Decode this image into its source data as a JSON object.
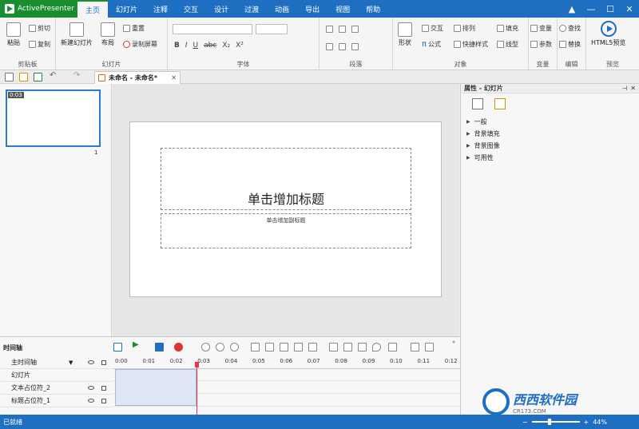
{
  "app": {
    "name": "ActivePresenter"
  },
  "tabs": [
    "主页",
    "幻灯片",
    "注释",
    "交互",
    "设计",
    "过渡",
    "动画",
    "导出",
    "视图",
    "帮助"
  ],
  "window_controls": [
    "▲",
    "—",
    "☐",
    "✕"
  ],
  "ribbon": {
    "clipboard": {
      "paste": "粘贴",
      "cut": "剪切",
      "copy": "复制",
      "label": "剪贴板"
    },
    "slides": {
      "new_slide": "新建幻灯片",
      "layout": "布局",
      "reset": "重置",
      "record_screen": "录制屏幕",
      "label": "幻灯片"
    },
    "font": {
      "bold": "B",
      "italic": "I",
      "underline": "U",
      "strike": "abc",
      "subscript": "X₂",
      "superscript": "X²",
      "label": "字体"
    },
    "paragraph": {
      "label": "段落"
    },
    "objects": {
      "shape": "形状",
      "interaction": "交互",
      "formula": "公式",
      "arrange": "排列",
      "quick_style": "快捷样式",
      "fill": "填充",
      "line": "线型",
      "label": "对象"
    },
    "variables": {
      "variable": "变量",
      "param": "参数",
      "label": "变量"
    },
    "edit": {
      "find": "查找",
      "replace": "替换",
      "label": "编辑"
    },
    "preview": {
      "html5": "HTML5预览",
      "label": "预览"
    }
  },
  "document_tab": {
    "title": "未命名 - 未命名*",
    "close": "✕"
  },
  "slides_pane": {
    "thumb_time": "0:03",
    "thumb_number": "1"
  },
  "slide": {
    "title_placeholder": "单击增加标题",
    "subtitle_placeholder": "单击增加副标题"
  },
  "properties": {
    "title": "属性 - 幻灯片",
    "sections": [
      "一般",
      "背景填充",
      "背景图像",
      "可用性"
    ]
  },
  "timeline": {
    "title": "时间轴",
    "main_timeline": "主时间轴",
    "rows": [
      "幻灯片",
      "文本占位符_2",
      "标题占位符_1"
    ],
    "ticks": [
      "0:00",
      "0:01",
      "0:02",
      "0:03",
      "0:04",
      "0:05",
      "0:06",
      "0:07",
      "0:08",
      "0:09",
      "0:10",
      "0:11",
      "0:12"
    ]
  },
  "status": {
    "text": "已就绪",
    "zoom": "44%"
  },
  "watermark": {
    "text": "西西软件园",
    "url": "CR173.COM"
  },
  "colors": {
    "accent": "#1e6fc2",
    "app_green": "#1a8d2f",
    "playhead": "#e33344"
  }
}
